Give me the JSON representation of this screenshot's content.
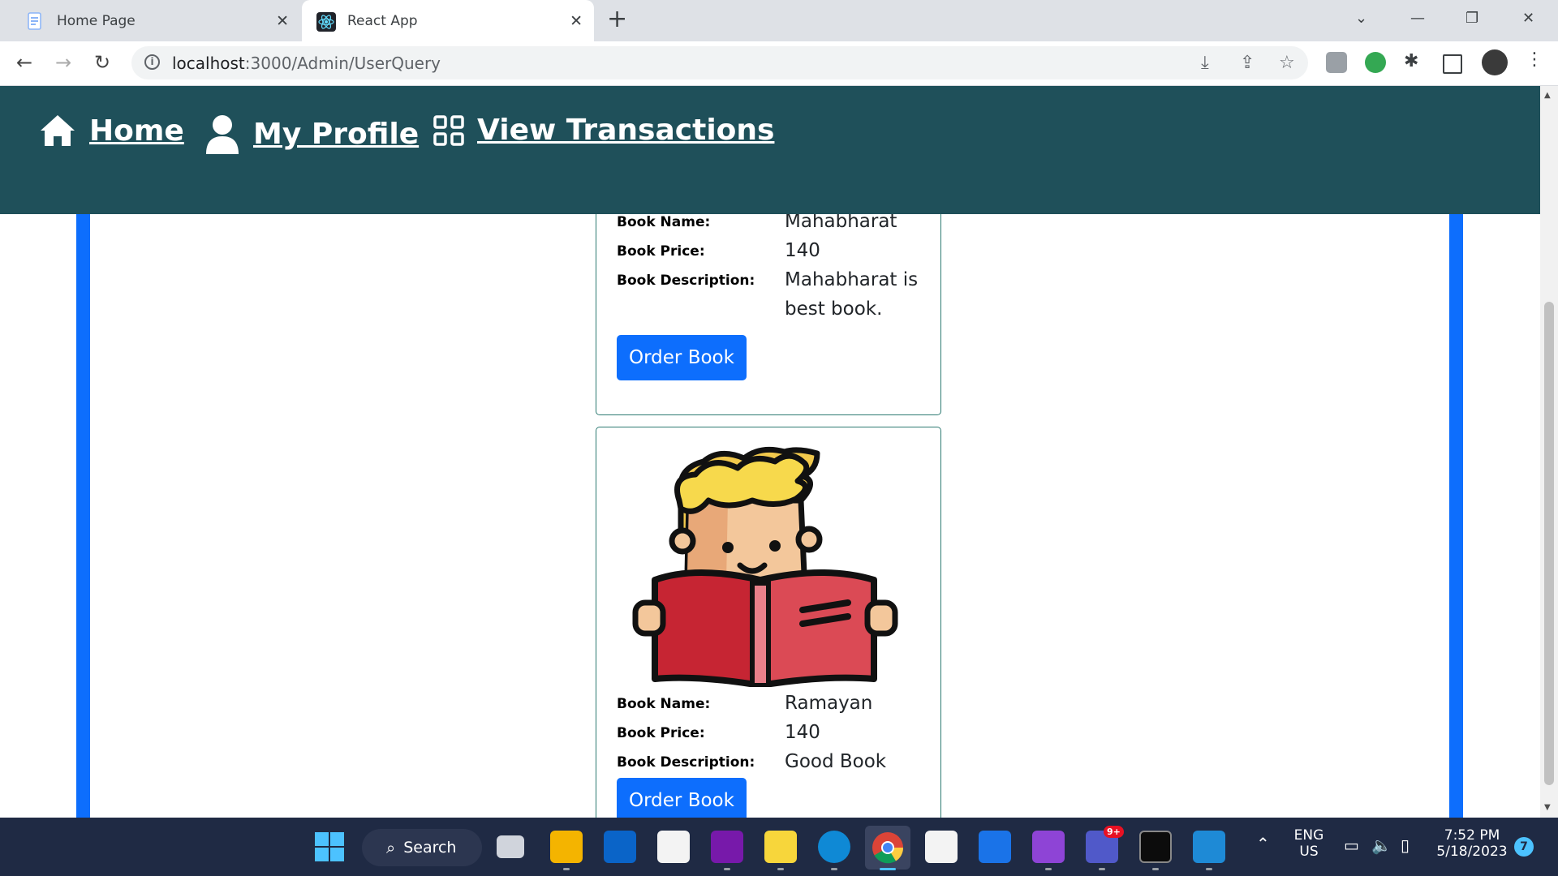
{
  "browser": {
    "tabs": [
      {
        "title": "Home Page",
        "active": false
      },
      {
        "title": "React App",
        "active": true
      }
    ],
    "url_host": "localhost",
    "url_path": ":3000/Admin/UserQuery"
  },
  "nav": {
    "home": "Home",
    "profile": "My Profile",
    "transactions": "View Transactions"
  },
  "books": [
    {
      "name_label": "Book Name:",
      "name": "Mahabharat",
      "price_label": "Book Price:",
      "price": "140",
      "desc_label": "Book Description:",
      "description_line1": "Mahabharat is",
      "description_line2": "best book.",
      "button": "Order Book"
    },
    {
      "name_label": "Book Name:",
      "name": "Ramayan",
      "price_label": "Book Price:",
      "price": "140",
      "desc_label": "Book Description:",
      "description": "Good Book",
      "button": "Order Book"
    }
  ],
  "taskbar": {
    "search": "Search",
    "lang_line1": "ENG",
    "lang_line2": "US",
    "time": "7:52 PM",
    "date": "5/18/2023",
    "teams_badge": "9+",
    "notif_count": "7"
  },
  "colors": {
    "nav_bg": "#1f505a",
    "accent_blue": "#0d6efd",
    "card_border": "#2d7a72"
  }
}
